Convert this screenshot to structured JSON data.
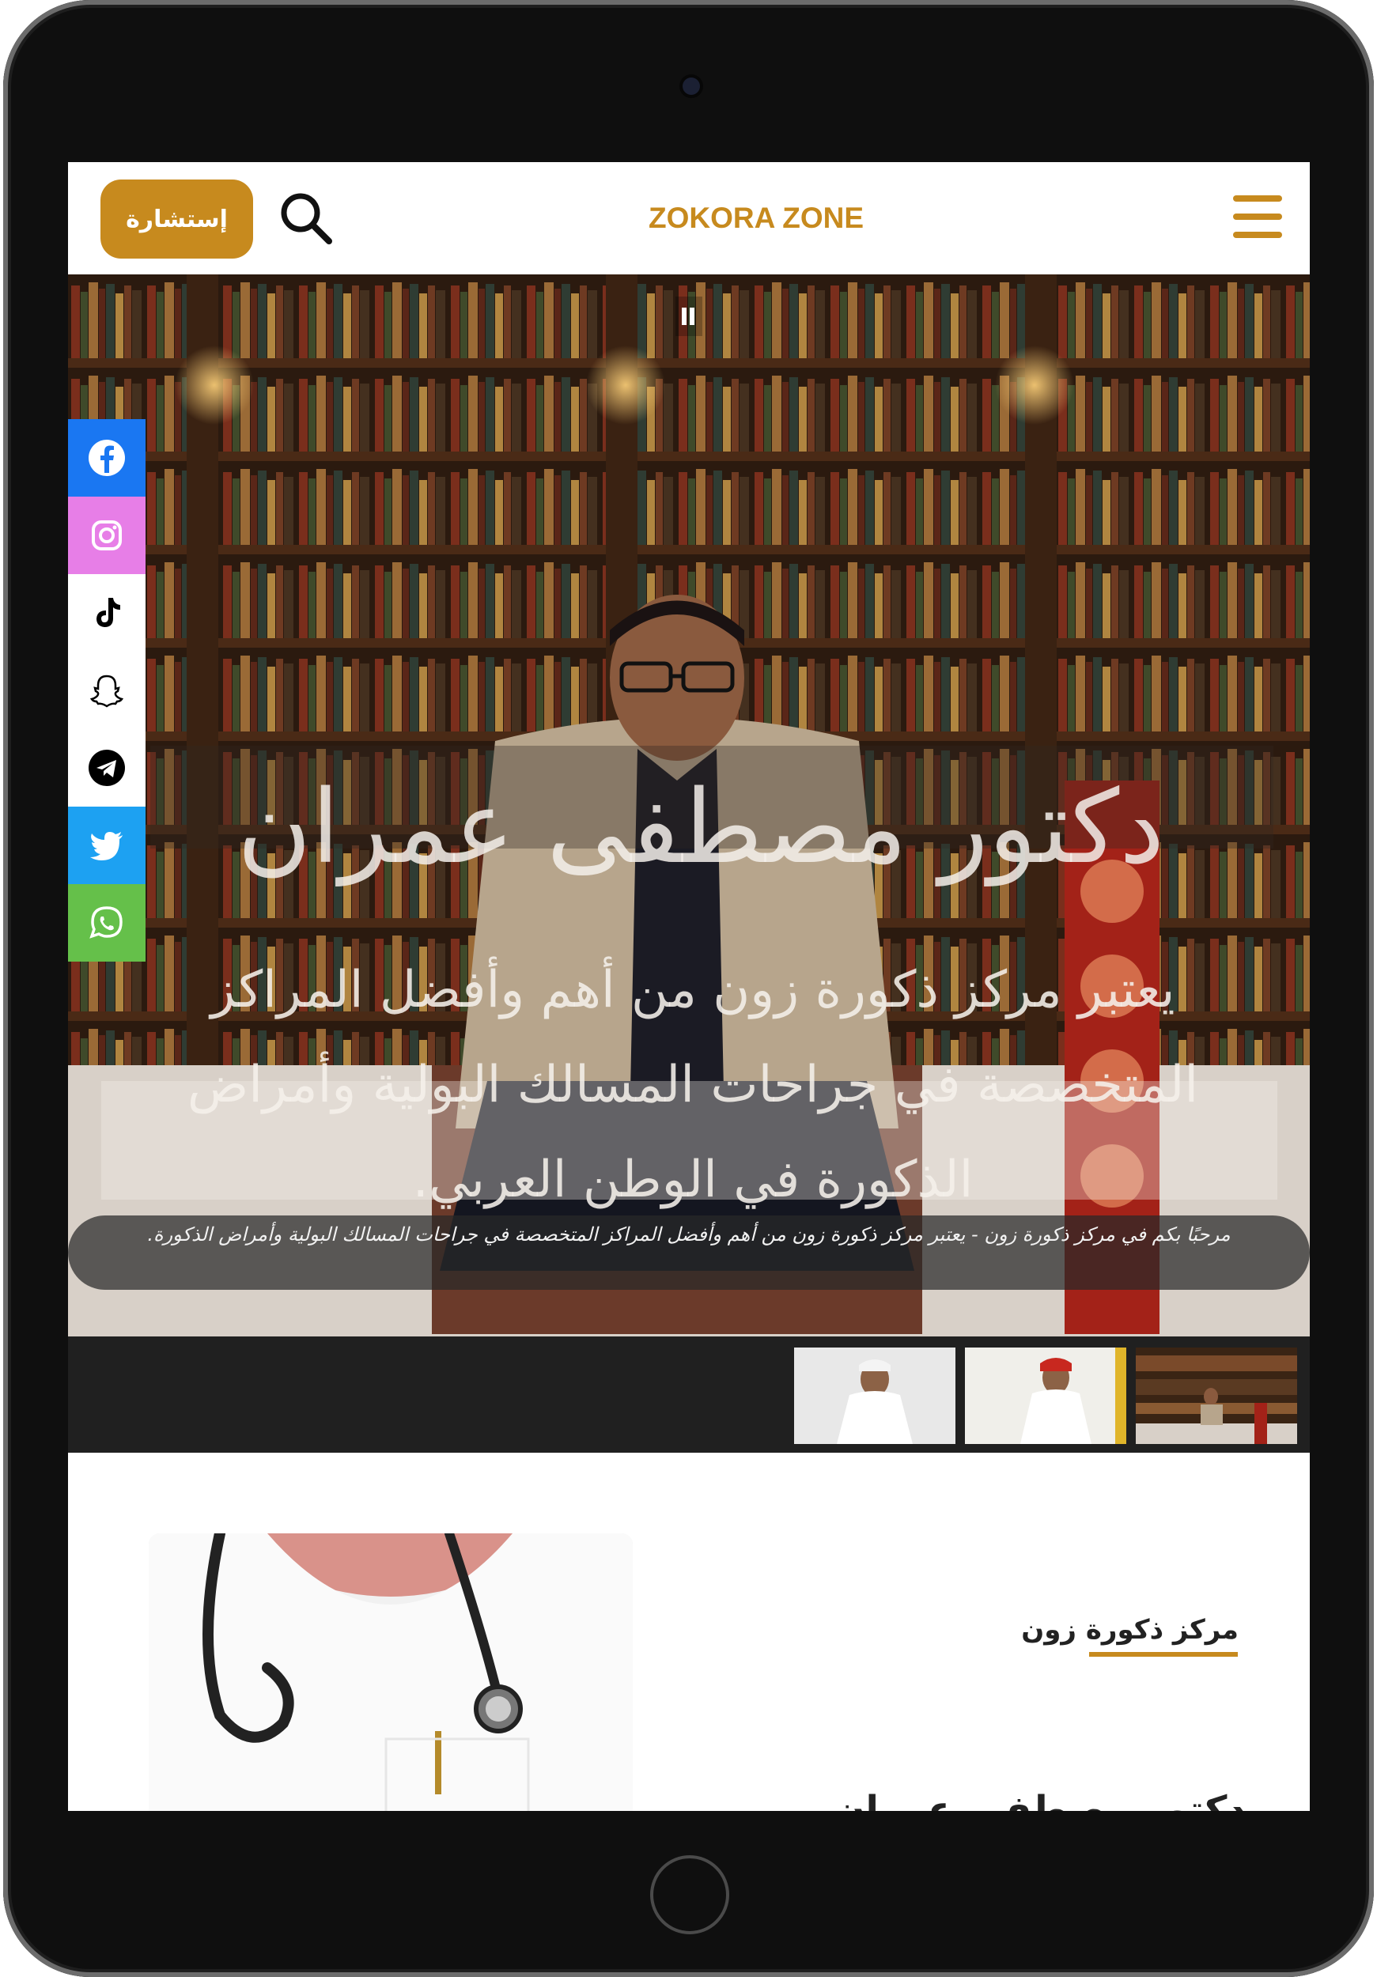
{
  "header": {
    "consult_label": "إستشارة",
    "logo_text": "ZOKORA ZONE"
  },
  "hero": {
    "title": "دكتور مصطفى عمران",
    "description": "يعتبر مركز ذكورة زون من أهم وأفضل المراكز المتخصصة في جراحات المسالك البولية وأمراض الذكورة في الوطن العربي.",
    "caption": "مرحبًا بكم في مركز ذكورة زون - يعتبر مركز ذكورة زون من أهم وأفضل المراكز المتخصصة في جراحات المسالك البولية وأمراض الذكورة."
  },
  "social": [
    {
      "name": "facebook",
      "color": "#1a77f2"
    },
    {
      "name": "instagram",
      "color": "#e77ee7"
    },
    {
      "name": "tiktok",
      "color": "#ffffff"
    },
    {
      "name": "snapchat",
      "color": "#ffffff"
    },
    {
      "name": "telegram",
      "color": "#ffffff"
    },
    {
      "name": "twitter",
      "color": "#1da1f2"
    },
    {
      "name": "whatsapp",
      "color": "#65c04a"
    }
  ],
  "about": {
    "label": "مركز ذكورة زون",
    "heading": "دكتور مصطفى عمران"
  },
  "colors": {
    "accent": "#c78a1e",
    "thumbs_bar": "#202020"
  }
}
